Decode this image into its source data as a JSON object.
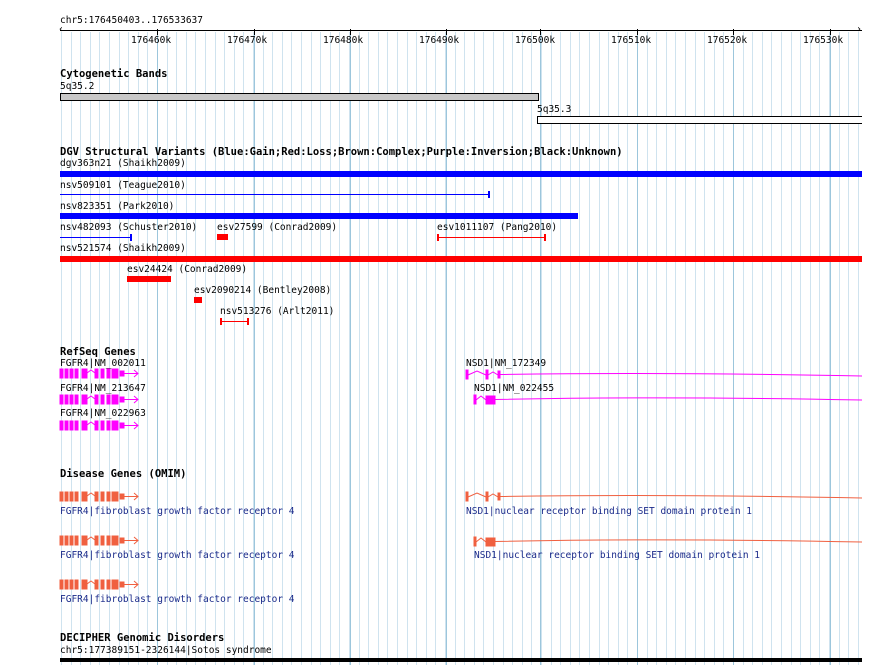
{
  "ruler": {
    "range": "chr5:176450403..176533637",
    "ticks": [
      "176460k",
      "176470k",
      "176480k",
      "176490k",
      "176500k",
      "176510k",
      "176520k",
      "176530k"
    ]
  },
  "cytobands": {
    "title": "Cytogenetic Bands",
    "bands": [
      {
        "name": "5q35.2",
        "fill": "#c8c8c8"
      },
      {
        "name": "5q35.3",
        "fill": "#ffffff"
      }
    ]
  },
  "dgv": {
    "title": "DGV Structural Variants (Blue:Gain;Red:Loss;Brown:Complex;Purple:Inversion;Black:Unknown)",
    "variants": [
      {
        "label": "dgv363n21 (Shaikh2009)",
        "color": "#0000ff"
      },
      {
        "label": "nsv509101 (Teague2010)",
        "color": "#0000ff"
      },
      {
        "label": "nsv823351 (Park2010)",
        "color": "#0000ff"
      },
      {
        "label": "nsv482093 (Schuster2010)",
        "color": "#0000ff"
      },
      {
        "label": "esv27599 (Conrad2009)",
        "color": "#ff0000"
      },
      {
        "label": "esv1011107 (Pang2010)",
        "color": "#ff0000"
      },
      {
        "label": "nsv521574 (Shaikh2009)",
        "color": "#ff0000"
      },
      {
        "label": "esv24424 (Conrad2009)",
        "color": "#ff0000"
      },
      {
        "label": "esv2090214 (Bentley2008)",
        "color": "#ff0000"
      },
      {
        "label": "nsv513276 (Arlt2011)",
        "color": "#ff0000"
      }
    ]
  },
  "refseq": {
    "title": "RefSeq Genes",
    "color": "#ff00ff",
    "genes": [
      {
        "label": "FGFR4|NM_002011"
      },
      {
        "label": "FGFR4|NM_213647"
      },
      {
        "label": "FGFR4|NM_022963"
      },
      {
        "label": "NSD1|NM_172349"
      },
      {
        "label": "NSD1|NM_022455"
      }
    ]
  },
  "omim": {
    "title": "Disease Genes (OMIM)",
    "color": "#f06040",
    "genes": [
      {
        "label": "FGFR4|fibroblast growth factor receptor 4"
      },
      {
        "label": "FGFR4|fibroblast growth factor receptor 4"
      },
      {
        "label": "FGFR4|fibroblast growth factor receptor 4"
      },
      {
        "label": "NSD1|nuclear receptor binding SET domain protein 1"
      },
      {
        "label": "NSD1|nuclear receptor binding SET domain protein 1"
      }
    ]
  },
  "decipher": {
    "title": "DECIPHER Genomic Disorders",
    "label": "chr5:177389151-2326144|Sotos syndrome"
  }
}
